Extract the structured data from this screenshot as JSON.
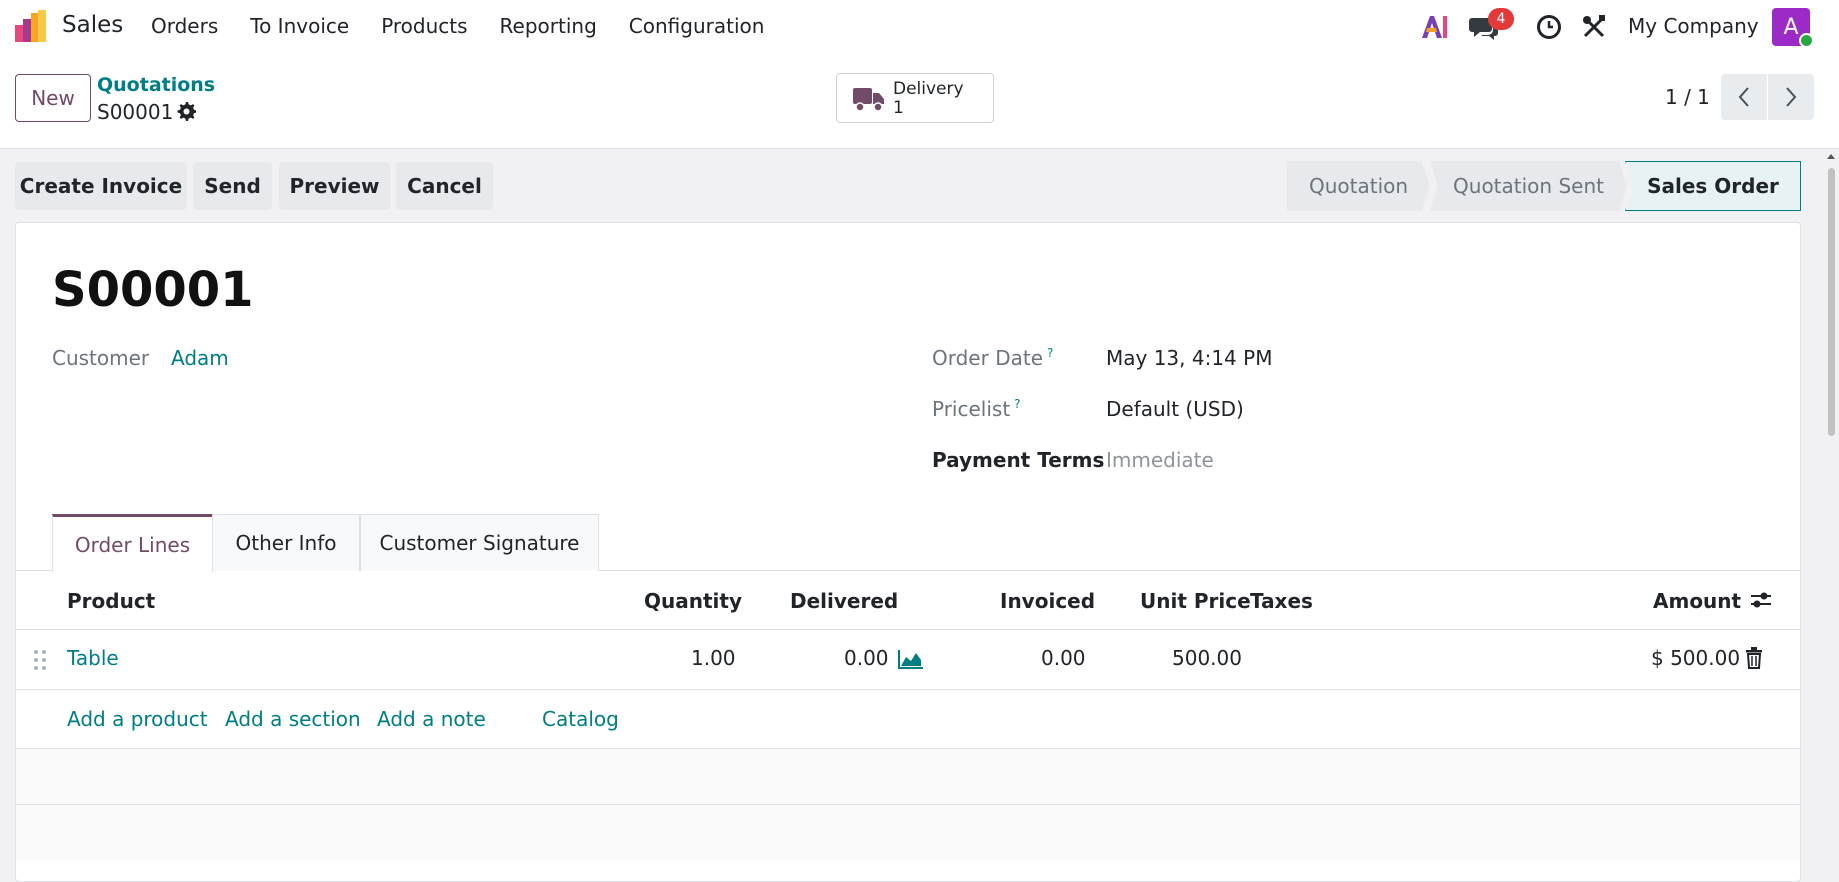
{
  "navbar": {
    "app_name": "Sales",
    "menu": [
      "Orders",
      "To Invoice",
      "Products",
      "Reporting",
      "Configuration"
    ],
    "messages_count": "4",
    "company": "My Company",
    "avatar_letter": "A",
    "icons": [
      "sales-logo-icon",
      "ai-icon",
      "chat-icon",
      "clock-icon",
      "tools-icon"
    ]
  },
  "control": {
    "new_label": "New",
    "breadcrumb": "Quotations",
    "record_name": "S00001",
    "smart_button": {
      "label": "Delivery",
      "count": "1",
      "icon": "truck-icon"
    },
    "pager": "1 / 1"
  },
  "actions": [
    "Create Invoice",
    "Send",
    "Preview",
    "Cancel"
  ],
  "stages": [
    "Quotation",
    "Quotation Sent",
    "Sales Order"
  ],
  "active_stage": "Sales Order",
  "form": {
    "title": "S00001",
    "customer_label": "Customer",
    "customer": "Adam",
    "order_date_label": "Order Date",
    "order_date": "May 13, 4:14 PM",
    "pricelist_label": "Pricelist",
    "pricelist": "Default (USD)",
    "payment_terms_label": "Payment Terms",
    "payment_terms": "Immediate",
    "help_mark": "?"
  },
  "tabs": [
    "Order Lines",
    "Other Info",
    "Customer Signature"
  ],
  "table": {
    "columns": [
      "Product",
      "Quantity",
      "Delivered",
      "Invoiced",
      "Unit Price",
      "Taxes",
      "Amount"
    ],
    "rows": [
      {
        "product": "Table",
        "quantity": "1.00",
        "delivered": "0.00",
        "invoiced": "0.00",
        "unit_price": "500.00",
        "taxes": "",
        "amount": "$ 500.00"
      }
    ],
    "add_links": [
      "Add a product",
      "Add a section",
      "Add a note",
      "Catalog"
    ]
  },
  "colors": {
    "brand": "#714b67",
    "link": "#017e84",
    "badge": "#e33939",
    "avatar": "#9b2ac7"
  }
}
